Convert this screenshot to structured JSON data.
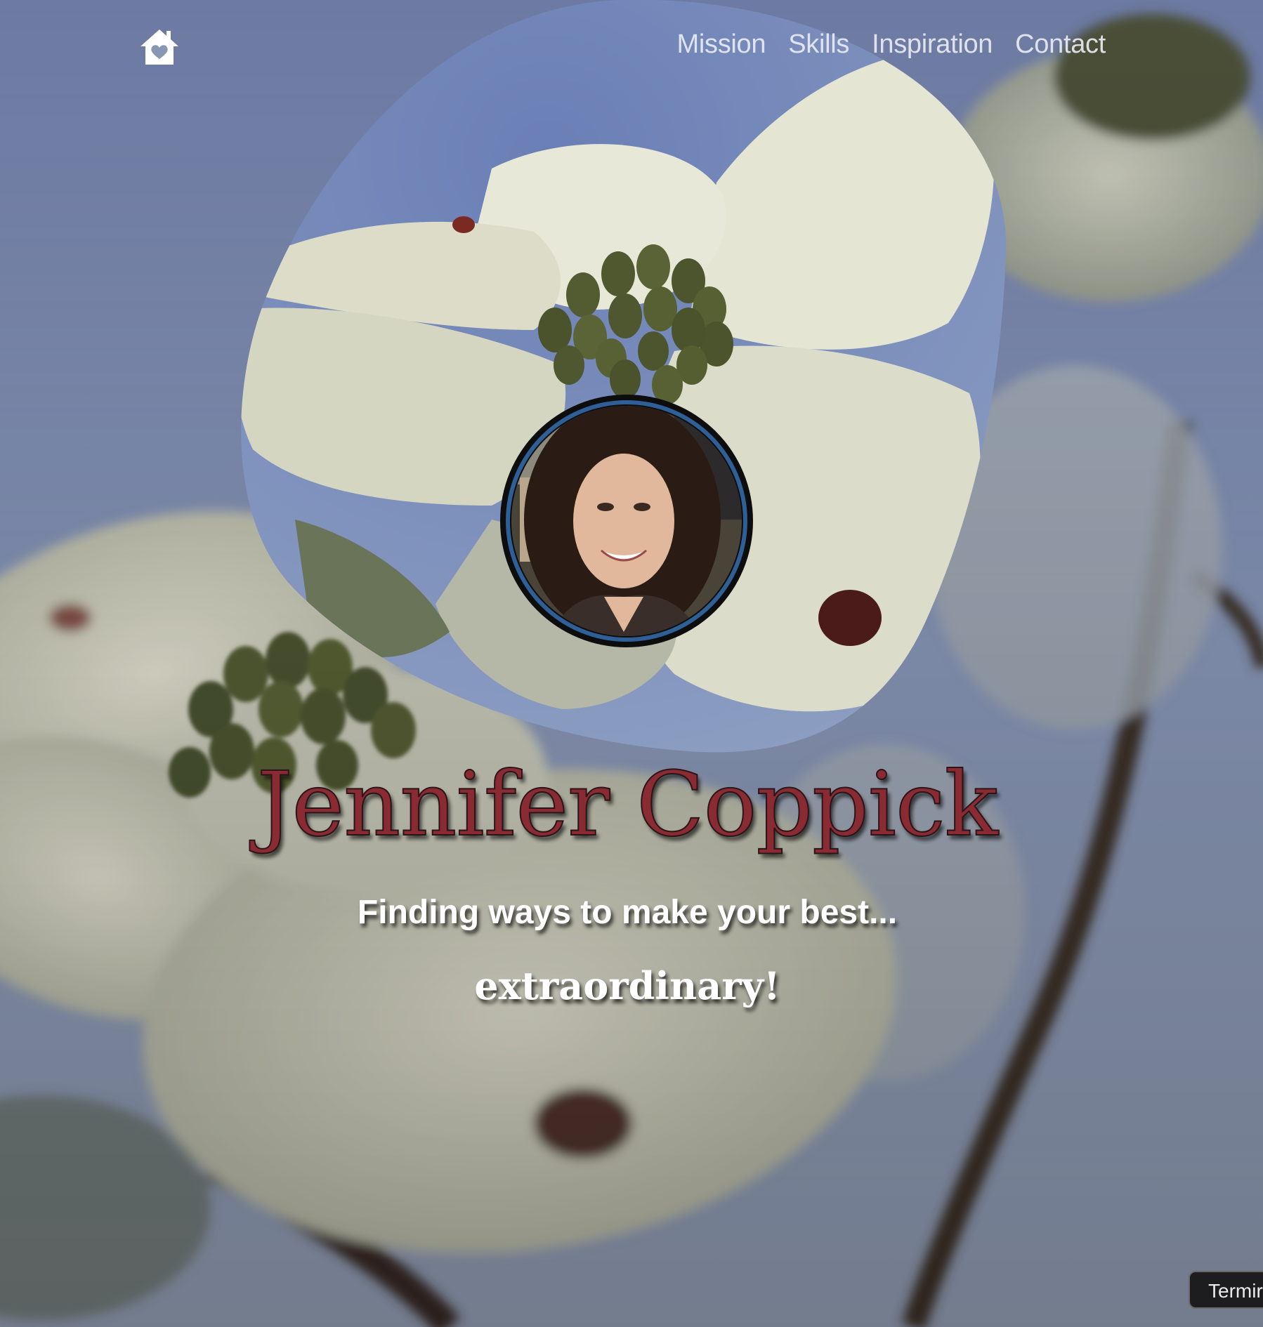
{
  "nav": {
    "home_icon": "home-heart-icon",
    "links": [
      {
        "label": "Mission"
      },
      {
        "label": "Skills"
      },
      {
        "label": "Inspiration"
      },
      {
        "label": "Contact"
      }
    ]
  },
  "hero": {
    "name": "Jennifer Coppick",
    "tagline": "Finding ways to make your best...",
    "tagline_emphasis": "extraordinary!",
    "avatar_icon": "profile-photo-avatar"
  },
  "terminal": {
    "label": "Termir"
  },
  "colors": {
    "name_color": "#8a2a32",
    "avatar_ring": "#2e5f96",
    "sky": "#7d8fb8"
  }
}
